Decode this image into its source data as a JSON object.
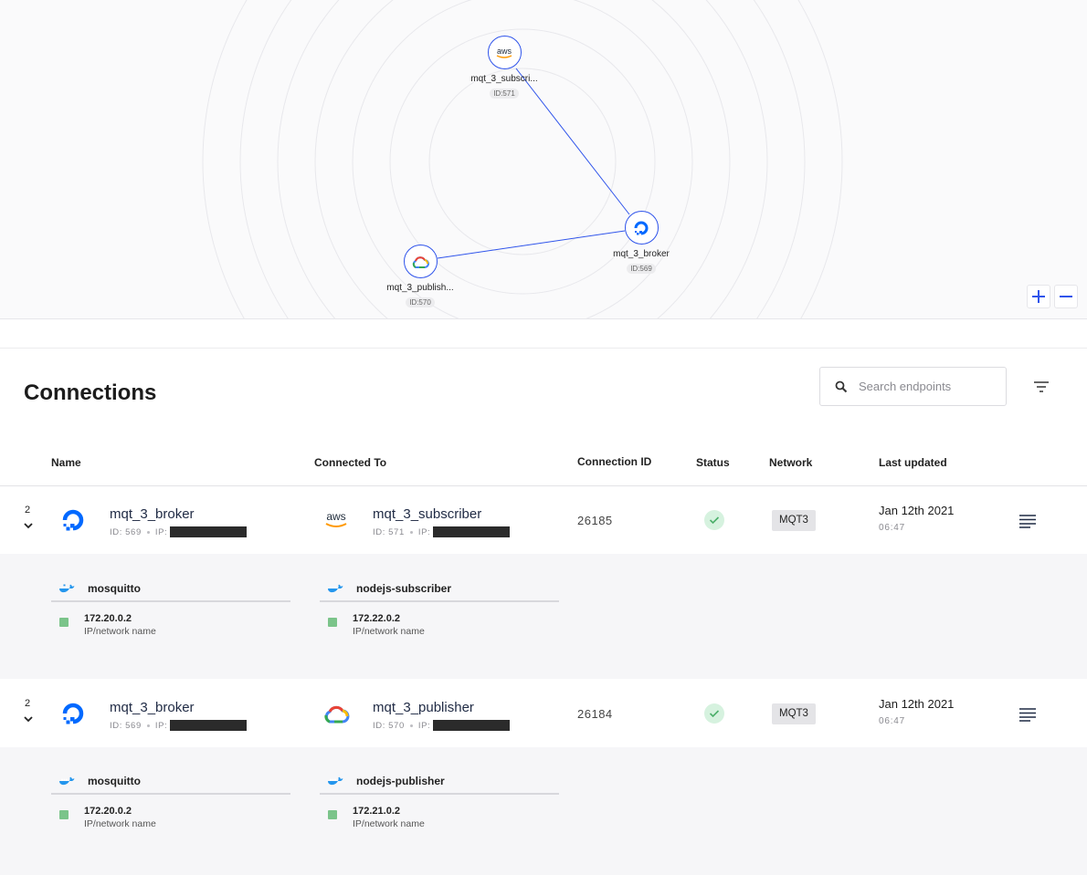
{
  "topology": {
    "nodes": [
      {
        "key": "aws",
        "name": "mqt_3_subscri...",
        "id_label": "ID:571",
        "logo": "aws-logo"
      },
      {
        "key": "do",
        "name": "mqt_3_broker",
        "id_label": "ID:569",
        "logo": "digitalocean-logo"
      },
      {
        "key": "gcp",
        "name": "mqt_3_publish...",
        "id_label": "ID:570",
        "logo": "google-cloud-logo"
      }
    ],
    "zoom_in_icon": "plus-icon",
    "zoom_out_icon": "minus-icon",
    "accent": "#2f54eb"
  },
  "connections": {
    "title": "Connections",
    "search_placeholder": "Search endpoints",
    "columns": {
      "name": "Name",
      "connected_to": "Connected To",
      "connection_id": "Connection ID",
      "status": "Status",
      "network": "Network",
      "last_updated": "Last updated"
    },
    "rows": [
      {
        "count": "2",
        "source": {
          "name": "mqt_3_broker",
          "id_text": "ID: 569",
          "ip_label": "IP:",
          "logo": "digitalocean-logo"
        },
        "target": {
          "name": "mqt_3_subscriber",
          "id_text": "ID: 571",
          "ip_label": "IP:",
          "logo": "aws-logo"
        },
        "connection_id": "26185",
        "status": "ok",
        "network": "MQT3",
        "date": "Jan 12th 2021",
        "time": "06:47",
        "services": [
          {
            "name": "mosquitto",
            "ip": "172.20.0.2",
            "ip_label": "IP/network name"
          },
          {
            "name": "nodejs-subscriber",
            "ip": "172.22.0.2",
            "ip_label": "IP/network name"
          }
        ]
      },
      {
        "count": "2",
        "source": {
          "name": "mqt_3_broker",
          "id_text": "ID: 569",
          "ip_label": "IP:",
          "logo": "digitalocean-logo"
        },
        "target": {
          "name": "mqt_3_publisher",
          "id_text": "ID: 570",
          "ip_label": "IP:",
          "logo": "google-cloud-logo"
        },
        "connection_id": "26184",
        "status": "ok",
        "network": "MQT3",
        "date": "Jan 12th 2021",
        "time": "06:47",
        "services": [
          {
            "name": "mosquitto",
            "ip": "172.20.0.2",
            "ip_label": "IP/network name"
          },
          {
            "name": "nodejs-publisher",
            "ip": "172.21.0.2",
            "ip_label": "IP/network name"
          }
        ]
      }
    ],
    "status_color": "#d6f2df",
    "network_square_color": "#7bc48a"
  }
}
